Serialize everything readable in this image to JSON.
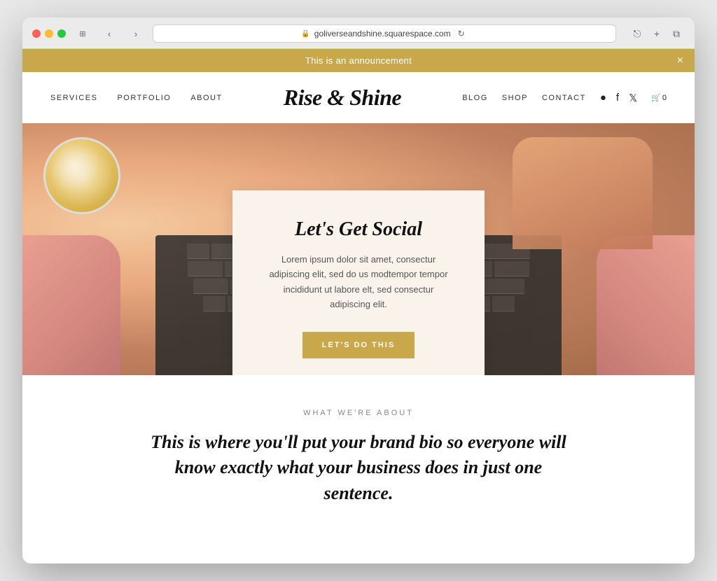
{
  "browser": {
    "url": "goliverseandshine.squarespace.com",
    "back_label": "‹",
    "forward_label": "›"
  },
  "announcement": {
    "text": "This is an announcement",
    "close_label": "×"
  },
  "nav": {
    "logo": "Rise & Shine",
    "left_links": [
      {
        "label": "SERVICES",
        "id": "services"
      },
      {
        "label": "PORTFOLIO",
        "id": "portfolio"
      },
      {
        "label": "ABOUT",
        "id": "about"
      }
    ],
    "right_links": [
      {
        "label": "BLOG",
        "id": "blog"
      },
      {
        "label": "SHOP",
        "id": "shop"
      },
      {
        "label": "CONTACT",
        "id": "contact"
      }
    ],
    "cart_count": "0"
  },
  "hero": {
    "card": {
      "title": "Let's Get Social",
      "body": "Lorem ipsum dolor sit amet, consectur adipiscing elit, sed do us modtempor tempor incididunt ut labore elt, sed consectur adipiscing elit.",
      "button_label": "LET'S DO THIS"
    }
  },
  "about": {
    "label": "WHAT WE'RE ABOUT",
    "headline": "This is where you'll put your brand bio so everyone will know exactly what your business does in just one sentence."
  },
  "colors": {
    "announcement_bg": "#c9a84c",
    "card_bg": "#faf3ec",
    "button_bg": "#c9a84c"
  }
}
